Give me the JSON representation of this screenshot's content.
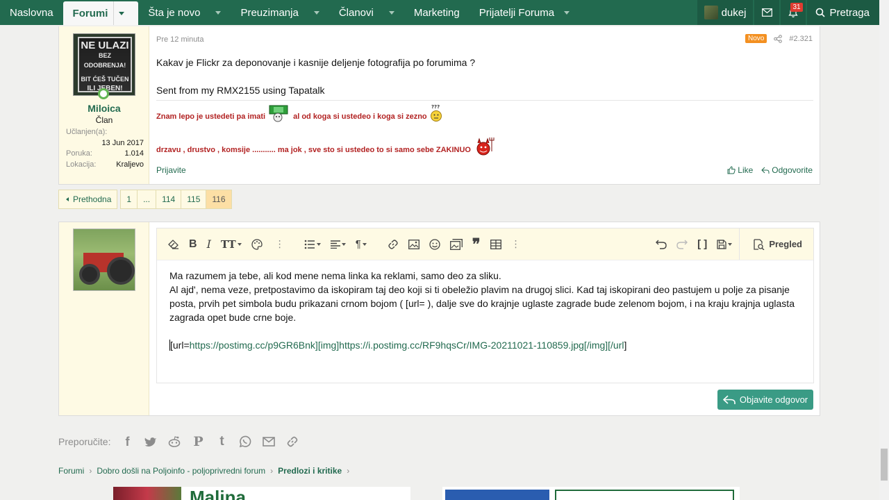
{
  "nav": {
    "items": [
      {
        "label": "Naslovna",
        "dropdown": false
      },
      {
        "label": "Forumi",
        "dropdown": true,
        "active": true
      },
      {
        "label": "Šta je novo",
        "dropdown": true
      },
      {
        "label": "Preuzimanja",
        "dropdown": true
      },
      {
        "label": "Članovi",
        "dropdown": true
      },
      {
        "label": "Marketing",
        "dropdown": false
      },
      {
        "label": "Prijatelji Foruma",
        "dropdown": true
      }
    ],
    "user": "dukej",
    "alerts_count": "31",
    "search_label": "Pretraga"
  },
  "post": {
    "time": "Pre 12 minuta",
    "new_badge": "Novo",
    "number": "#2.321",
    "author": {
      "name": "Miloica",
      "title": "Član",
      "avatar_text": [
        "NE ULAZI",
        "BEZ ODOBRENJA!",
        "BIT ĆEŠ TUČEN",
        "ILI JEBEN!"
      ],
      "joined_label": "Učlanjen(a):",
      "joined": "13 Jun 2017",
      "posts_label": "Poruka:",
      "posts": "1.014",
      "location_label": "Lokacija:",
      "location": "Kraljevo"
    },
    "body": [
      "Kakav je Flickr za deponovanje i kasnije deljenje fotografija po forumima ?",
      "Sent from my RMX2155 using Tapatalk"
    ],
    "signature": {
      "line1a": "Znam lepo je ustedeti pa imati",
      "line1b": "al od koga si ustedeo i koga si zezno",
      "line2": "drzavu , drustvo , komsije ........... ma jok , sve sto si ustedeo to si samo sebe ZAKINUO"
    },
    "report": "Prijavite",
    "like": "Like",
    "reply": "Odgovorite"
  },
  "pagination": {
    "prev": "Prethodna",
    "pages": [
      "1",
      "...",
      "114",
      "115",
      "116"
    ],
    "current": "116"
  },
  "editor": {
    "preview": "Pregled",
    "lines": [
      "Ma razumem ja tebe, ali kod mene nema linka ka reklami, samo deo za sliku.",
      "Al ajd', nema veze, pretpostavimo da iskopiram taj deo koji si ti obeležio plavim na drugoj slici. Kad taj iskopirani deo pastujem u polje za pisanje posta, prvih pet simbola budu prikazani crnom bojom ( [url= ), dalje sve do krajnje uglaste zagrade bude zelenom bojom, i na kraju krajnja uglasta zagrada opet bude crne boje."
    ],
    "code_prefix": "[url=",
    "code_link": "https://postimg.cc/p9GR6Bnk][img]https://i.postimg.cc/RF9hqsCr/IMG-20211021-110859.jpg[/img][/url",
    "code_suffix": "]",
    "submit": "Objavite odgovor"
  },
  "share": {
    "label": "Preporučite:",
    "icons": [
      "facebook-icon",
      "twitter-icon",
      "reddit-icon",
      "pinterest-icon",
      "tumblr-icon",
      "whatsapp-icon",
      "email-icon",
      "link-icon"
    ]
  },
  "breadcrumb": {
    "items": [
      "Forumi",
      "Dobro došli na Poljoinfo - poljoprivredni forum",
      "Predlozi i kritike"
    ]
  },
  "ads": {
    "ad1_text": "Malina"
  },
  "colors": {
    "brand": "#226a4f",
    "accent_button": "#3a9b85",
    "signature_red": "#b22222",
    "new_badge": "#f39021"
  }
}
